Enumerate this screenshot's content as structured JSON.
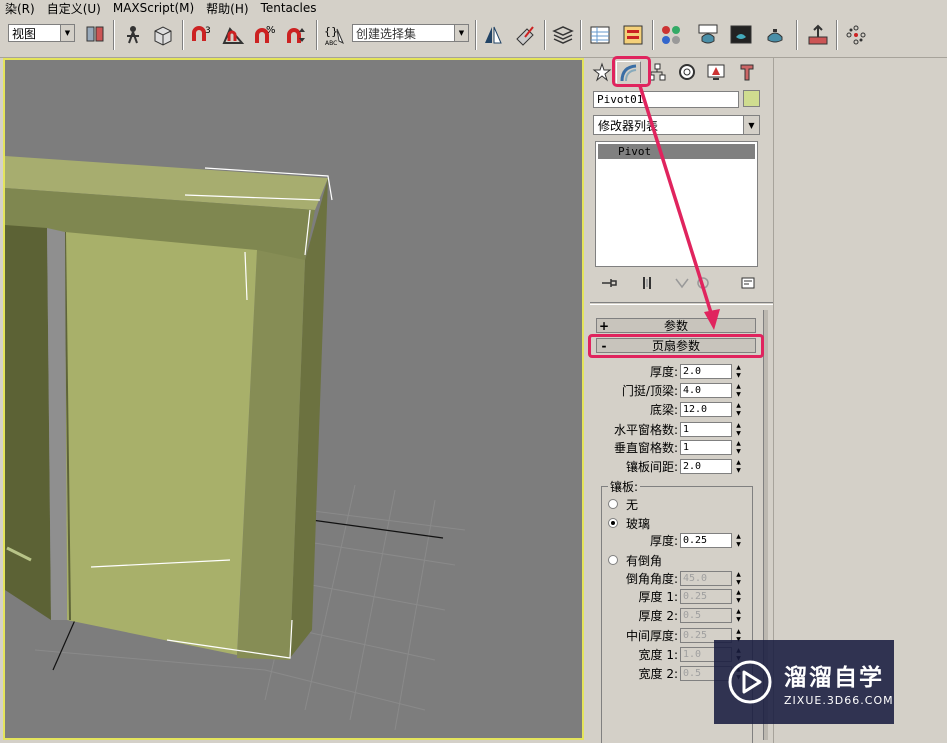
{
  "menu": {
    "items": [
      "染(R)",
      "自定义(U)",
      "MAXScript(M)",
      "帮助(H)",
      "Tentacles"
    ]
  },
  "toolbar": {
    "view_dropdown": "视图",
    "selection_set_placeholder": "创建选择集",
    "icons": [
      "layers-icon",
      "select-move-icon",
      "select-object-icon",
      "snap-3d-icon",
      "angle-snap-icon",
      "percent-snap-icon",
      "spinner-snap-icon",
      "named-selection-icon",
      "mirror-icon",
      "align-icon",
      "layer-manager-icon",
      "curve-editor-icon",
      "schematic-view-icon",
      "material-editor-icon",
      "render-setup-icon",
      "render-frame-icon",
      "quick-render-icon",
      "extra-icon-1",
      "extra-icon-2"
    ]
  },
  "command_panel": {
    "tabs": [
      "create-tab",
      "modify-tab",
      "hierarchy-tab",
      "motion-tab",
      "display-tab",
      "utilities-tab"
    ],
    "active_tab": "modify-tab",
    "object_name": "Pivot01",
    "object_color": "#cfdc8f",
    "modifier_list_label": "修改器列表",
    "stack_items": [
      "Pivot"
    ],
    "rollouts": [
      {
        "sign": "+",
        "title": "参数"
      },
      {
        "sign": "-",
        "title": "页扇参数"
      }
    ],
    "params": [
      {
        "label": "厚度:",
        "value": "2.0"
      },
      {
        "label": "门挺/顶梁:",
        "value": "4.0"
      },
      {
        "label": "底梁:",
        "value": "12.0"
      },
      {
        "label": "水平窗格数:",
        "value": "1"
      },
      {
        "label": "垂直窗格数:",
        "value": "1"
      },
      {
        "label": "镶板间距:",
        "value": "2.0"
      }
    ],
    "panel_group": {
      "title": "镶板:",
      "options": [
        "无",
        "玻璃",
        "有倒角"
      ],
      "selected": "玻璃",
      "glass_thickness_label": "厚度:",
      "glass_thickness_value": "0.25",
      "bevel_params": [
        {
          "label": "倒角角度:",
          "value": "45.0"
        },
        {
          "label": "厚度 1:",
          "value": "0.25"
        },
        {
          "label": "厚度 2:",
          "value": "0.5"
        },
        {
          "label": "中间厚度:",
          "value": "0.25"
        },
        {
          "label": "宽度 1:",
          "value": "1.0"
        },
        {
          "label": "宽度 2:",
          "value": "0.5"
        }
      ]
    }
  },
  "annotation": {
    "highlight_color": "#e0245e"
  },
  "watermark": {
    "cn": "溜溜自学",
    "en": "ZIXUE.3D66.COM"
  }
}
